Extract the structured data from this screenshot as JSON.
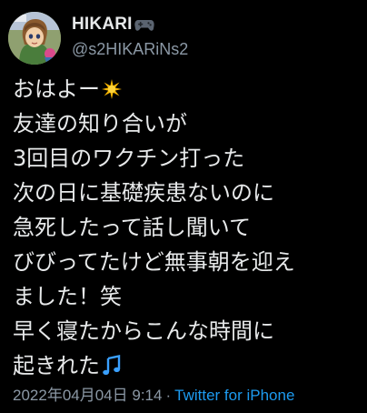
{
  "user": {
    "display_name": "HIKARI",
    "name_emoji": "gamepad-icon",
    "handle": "@s2HIKARiNs2"
  },
  "tweet": {
    "lines": [
      "おはよー",
      "友達の知り合いが",
      "3回目のワクチン打った",
      "次の日に基礎疾患ないのに",
      "急死したって話し聞いて",
      "びびってたけど無事朝を迎え",
      "ました！笑",
      "早く寝たからこんな時間に",
      "起きれた"
    ],
    "emojis": {
      "line_1": "sparkle-icon",
      "line_9": "music-notes-icon"
    }
  },
  "footer": {
    "date": "2022年04月04日 9:14",
    "separator": "·",
    "source": "Twitter for iPhone"
  },
  "colors": {
    "background": "#000000",
    "text_primary": "#e7e9ea",
    "text_secondary": "#8b98a5",
    "link": "#1d9bf0",
    "sparkle": "#f5b400",
    "music": "#3aa0ff"
  }
}
